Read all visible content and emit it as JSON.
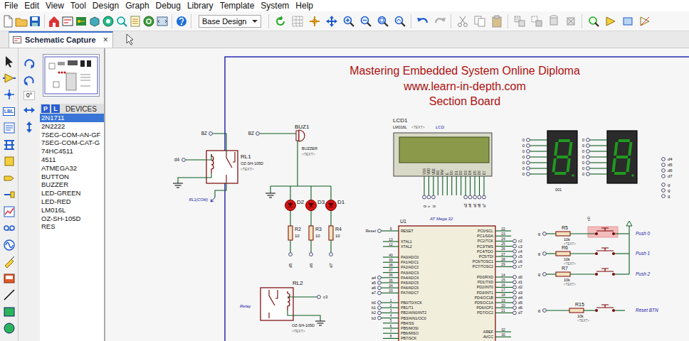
{
  "menu": [
    "File",
    "Edit",
    "View",
    "Tool",
    "Design",
    "Graph",
    "Debug",
    "Library",
    "Template",
    "System",
    "Help"
  ],
  "toolbar": {
    "design_select": "Base Design"
  },
  "tabs": [
    {
      "label": "Schematic Capture",
      "selected": true,
      "close": "×"
    }
  ],
  "toolstrip": {
    "label_tool": "LBL"
  },
  "side_panel": {
    "rotation": "0°",
    "library_buttons": [
      "P",
      "L"
    ],
    "title": "DEVICES",
    "devices": [
      {
        "label": "2N1711",
        "selected": true
      },
      {
        "label": "2N2222",
        "selected": false
      },
      {
        "label": "7SEG-COM-AN-GF",
        "selected": false
      },
      {
        "label": "7SEG-COM-CAT-G",
        "selected": false
      },
      {
        "label": "74HC4511",
        "selected": false
      },
      {
        "label": "4511",
        "selected": false
      },
      {
        "label": "ATMEGA32",
        "selected": false
      },
      {
        "label": "BUTTON",
        "selected": false
      },
      {
        "label": "BUZZER",
        "selected": false
      },
      {
        "label": "LED-GREEN",
        "selected": false
      },
      {
        "label": "LED-RED",
        "selected": false
      },
      {
        "label": "LM016L",
        "selected": false
      },
      {
        "label": "OZ-SH-105D",
        "selected": false
      },
      {
        "label": "RES",
        "selected": false
      }
    ]
  },
  "schematic": {
    "title_lines": [
      "Mastering Embedded System Online Diploma",
      "www.learn-in-depth.com",
      "Section Board"
    ],
    "relay1": {
      "ref": "RL1",
      "part": "OZ-SH-105D",
      "text": "<TEXT>",
      "coil_net": "d4",
      "contact_net": "BZ",
      "probe": "RL1(COM)"
    },
    "buzzer": {
      "ref": "BUZ1",
      "part": "BUZZER",
      "text": "<TEXT>",
      "net": "BZ"
    },
    "leds": [
      {
        "ref": "D2",
        "resistor": "R2",
        "value": "10",
        "net": "d5"
      },
      {
        "ref": "D3",
        "resistor": "R3",
        "value": "10",
        "net": "d6"
      },
      {
        "ref": "D1",
        "resistor": "R4",
        "value": "10",
        "net": "d7"
      }
    ],
    "lcd": {
      "ref": "LCD1",
      "part": "LM016L",
      "text": "<TEXT>",
      "tag": "LCD",
      "pins": [
        {
          "name": "VSS",
          "net": "g"
        },
        {
          "name": "VDD",
          "net": "v"
        },
        {
          "name": "VEE",
          "net": "g"
        },
        {
          "name": "RS"
        },
        {
          "name": "RW"
        },
        {
          "name": "E"
        },
        {
          "name": "D0"
        },
        {
          "name": "D1"
        },
        {
          "name": "D2"
        },
        {
          "name": "D3",
          "net": "a3"
        },
        {
          "name": "D4",
          "net": "a4"
        },
        {
          "name": "D5",
          "net": "a5"
        },
        {
          "name": "D6",
          "net": "a6"
        },
        {
          "name": "D7",
          "net": "a7"
        }
      ]
    },
    "displays": {
      "caption": "001",
      "units": [
        {
          "pins": [
            "0",
            "0",
            "0",
            "0",
            "0",
            "0",
            "0"
          ]
        },
        {
          "pins": [
            "0",
            "0",
            "0",
            "0",
            "0",
            "0",
            "0"
          ]
        }
      ],
      "side_nets": [
        "d4",
        "d5",
        "d6",
        "d7",
        "g",
        "g",
        "g"
      ]
    },
    "mcu": {
      "ref": "U1",
      "part": "AT Mega 32",
      "left_pins": [
        {
          "num": "9",
          "name": "RESET",
          "net": "Reset"
        },
        {
          "num": "13",
          "name": "XTAL1"
        },
        {
          "num": "12",
          "name": "XTAL2"
        },
        {
          "num": "40",
          "name": "PA0/ADC0"
        },
        {
          "num": "39",
          "name": "PA1/ADC1"
        },
        {
          "num": "38",
          "name": "PA2/ADC2"
        },
        {
          "num": "37",
          "name": "PA3/ADC3"
        },
        {
          "num": "36",
          "name": "PA4/ADC4",
          "net": "a4"
        },
        {
          "num": "35",
          "name": "PA5/ADC5",
          "net": "a5"
        },
        {
          "num": "34",
          "name": "PA6/ADC6",
          "net": "a6"
        },
        {
          "num": "33",
          "name": "PA7/ADC7",
          "net": "a7"
        },
        {
          "num": "1",
          "name": "PB0/T0/XCK",
          "net": "b0"
        },
        {
          "num": "2",
          "name": "PB1/T1",
          "net": "b1"
        },
        {
          "num": "3",
          "name": "PB2/AIN0/INT2",
          "net": "b2"
        },
        {
          "num": "4",
          "name": "PB3/AIN1/OC0",
          "net": "b3"
        },
        {
          "num": "5",
          "name": "PB4/SS"
        },
        {
          "num": "6",
          "name": "PB5/MOSI"
        },
        {
          "num": "7",
          "name": "PB6/MISO"
        },
        {
          "num": "8",
          "name": "PB7/SCK"
        }
      ],
      "right_pins": [
        {
          "num": "22",
          "name": "PC0/SCL"
        },
        {
          "num": "23",
          "name": "PC1/SDA"
        },
        {
          "num": "24",
          "name": "PC2/TCK",
          "net": "c2"
        },
        {
          "num": "25",
          "name": "PC3/TMS",
          "net": "c3"
        },
        {
          "num": "26",
          "name": "PC4/TDO",
          "net": "c4"
        },
        {
          "num": "27",
          "name": "PC5/TDI",
          "net": "c5"
        },
        {
          "num": "28",
          "name": "PC6/TOSC1",
          "net": "c6"
        },
        {
          "num": "29",
          "name": "PC7/TOSC2",
          "net": "c7"
        },
        {
          "num": "14",
          "name": "PD0/RXD",
          "net": "d0"
        },
        {
          "num": "15",
          "name": "PD1/TXD",
          "net": "d1"
        },
        {
          "num": "16",
          "name": "PD2/INT0",
          "net": "d2"
        },
        {
          "num": "17",
          "name": "PD3/INT1",
          "net": "d3"
        },
        {
          "num": "18",
          "name": "PD4/OC1B",
          "net": "d4"
        },
        {
          "num": "19",
          "name": "PD5/OC1A",
          "net": "d5"
        },
        {
          "num": "20",
          "name": "PD6/ICP1",
          "net": "d6"
        },
        {
          "num": "21",
          "name": "PD7/OC2",
          "net": "d7"
        },
        {
          "num": "32",
          "name": "AREF"
        },
        {
          "num": "30",
          "name": "AVCC"
        }
      ]
    },
    "buttons": {
      "net": "c0",
      "items": [
        {
          "ref": "R5",
          "value": "10k",
          "text": "<TEXT>",
          "net": "g",
          "label": "Push 0",
          "selected": true
        },
        {
          "ref": "R6",
          "value": "10k",
          "text": "<TEXT>",
          "net": "g",
          "label": "Push 1",
          "selected": false
        },
        {
          "ref": "R7",
          "value": "10k",
          "text": "<TEXT>",
          "net": "g",
          "label": "Push 2",
          "selected": false
        },
        {
          "ref": "R15",
          "value": "10k",
          "text": "<TEXT>",
          "net": "g",
          "label": "Reset BTN",
          "selected": false
        }
      ]
    },
    "relay2": {
      "ref": "RL2",
      "part": "OZ-SH-105D",
      "text": "<TEXT>",
      "tag": "Relay",
      "net": "c3"
    }
  }
}
